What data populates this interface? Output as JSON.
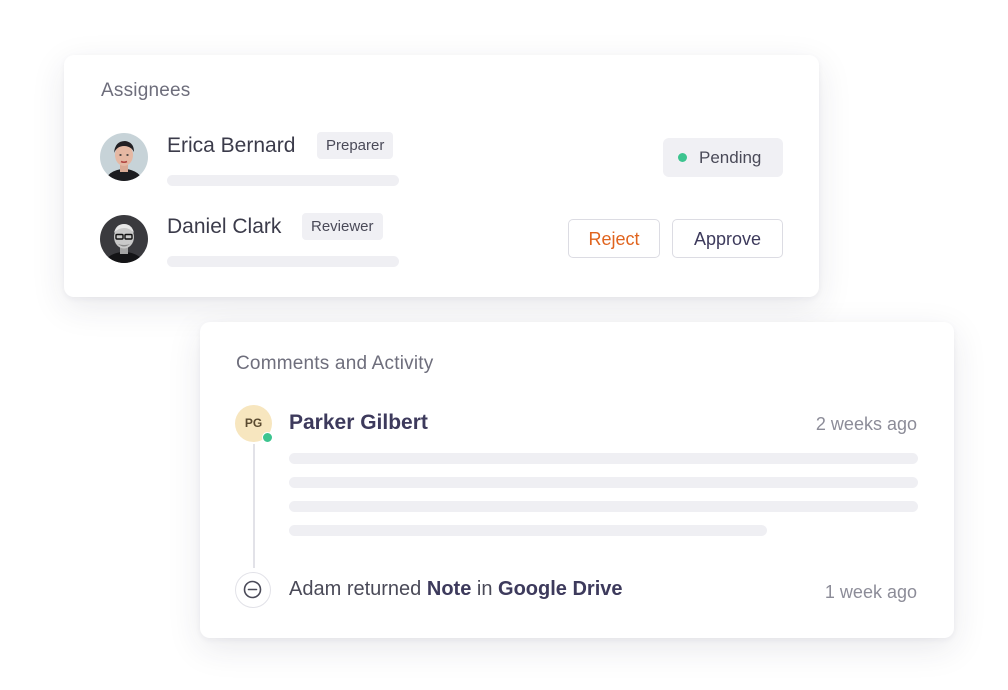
{
  "assignees": {
    "title": "Assignees",
    "people": [
      {
        "name": "Erica Bernard",
        "role": "Preparer"
      },
      {
        "name": "Daniel Clark",
        "role": "Reviewer"
      }
    ],
    "status": {
      "label": "Pending",
      "color": "#3cc48f"
    },
    "actions": {
      "reject_label": "Reject",
      "approve_label": "Approve",
      "reject_color": "#e0641e"
    }
  },
  "activity": {
    "title": "Comments and Activity",
    "comment": {
      "initials": "PG",
      "author": "Parker Gilbert",
      "time": "2 weeks ago",
      "online_color": "#3cc48f"
    },
    "event": {
      "actor": "Adam",
      "verb": "returned",
      "object": "Note",
      "preposition": "in",
      "location": "Google Drive",
      "time": "1 week ago",
      "icon": "minus-circle-icon"
    }
  }
}
